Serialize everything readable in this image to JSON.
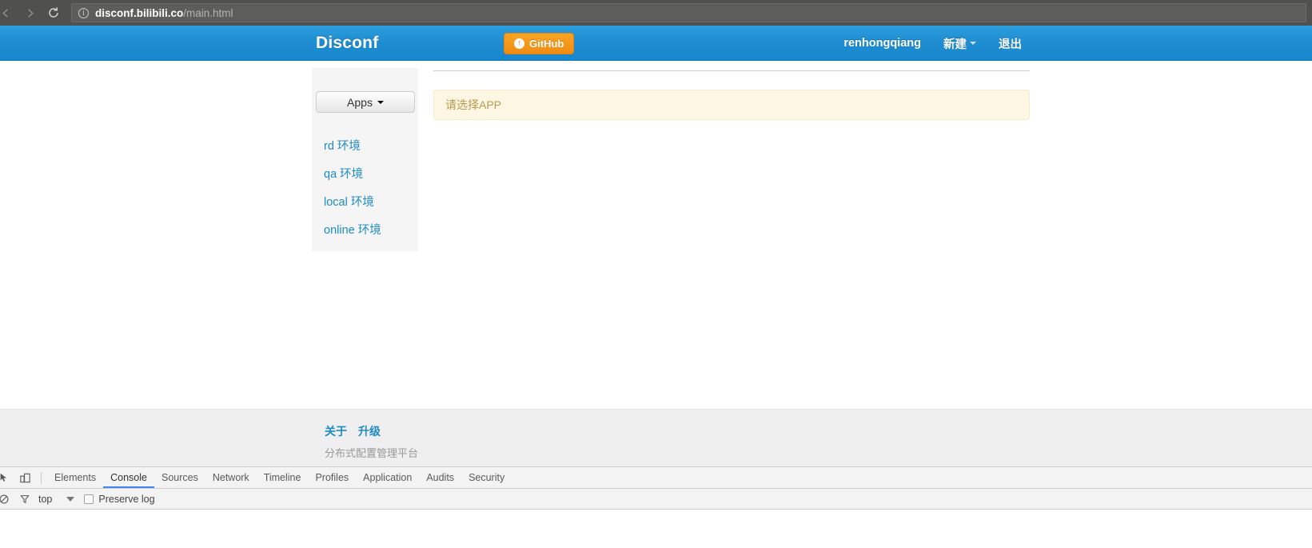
{
  "browser": {
    "back_icon": "back-arrow",
    "forward_icon": "forward-arrow",
    "reload_icon": "↻",
    "info_icon": "i",
    "url_host": "disconf.bilibili.co",
    "url_path": "/main.html"
  },
  "navbar": {
    "brand": "Disconf",
    "github_label": "GitHub",
    "github_icon": "↑",
    "username": "renhongqiang",
    "new_label": "新建",
    "logout_label": "退出"
  },
  "sidebar": {
    "apps_label": "Apps",
    "environments": [
      {
        "label": "rd 环境"
      },
      {
        "label": "qa 环境"
      },
      {
        "label": "local 环境"
      },
      {
        "label": "online 环境"
      }
    ]
  },
  "content": {
    "alert_text": "请选择APP"
  },
  "footer": {
    "links": [
      {
        "label": "关于"
      },
      {
        "label": "升级"
      }
    ],
    "tagline": "分布式配置管理平台"
  },
  "devtools": {
    "inspect_icon": "inspect-element",
    "device_icon": "device-toolbar",
    "tabs": [
      {
        "label": "Elements",
        "active": false
      },
      {
        "label": "Console",
        "active": true
      },
      {
        "label": "Sources",
        "active": false
      },
      {
        "label": "Network",
        "active": false
      },
      {
        "label": "Timeline",
        "active": false
      },
      {
        "label": "Profiles",
        "active": false
      },
      {
        "label": "Application",
        "active": false
      },
      {
        "label": "Audits",
        "active": false
      },
      {
        "label": "Security",
        "active": false
      }
    ],
    "clear_icon": "clear-console",
    "filter_icon": "funnel-filter",
    "context": "top",
    "preserve_log_label": "Preserve log"
  },
  "colors": {
    "navbar_blue": "#1f8cd0",
    "github_orange": "#f08c14",
    "link_blue": "#1e8bc3",
    "alert_bg": "#fcf6e3",
    "devtools_active": "#4285f4"
  }
}
